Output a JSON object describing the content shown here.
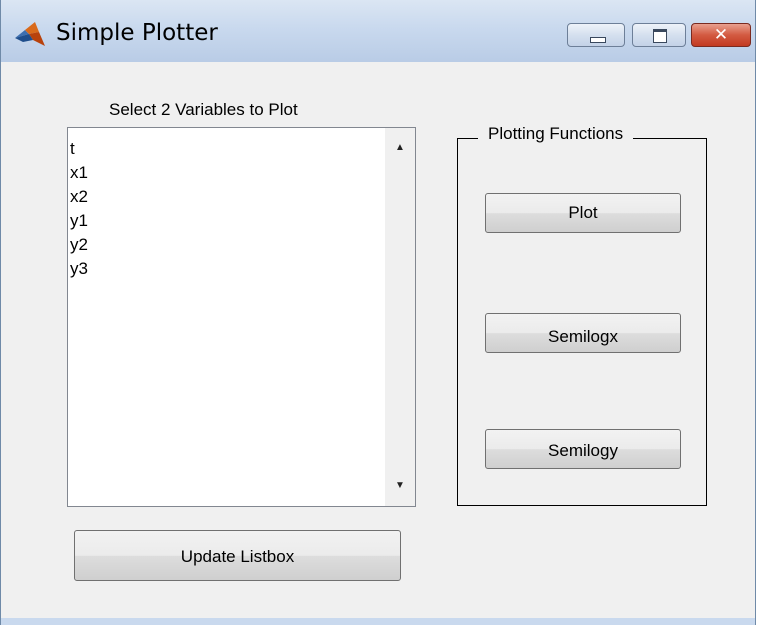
{
  "window": {
    "title": "Simple Plotter",
    "icon": "matlab-icon",
    "controls": {
      "minimize": "minimize-icon",
      "maximize": "maximize-icon",
      "close": "close-icon",
      "close_glyph": "✕"
    }
  },
  "listbox": {
    "title": "Select 2 Variables to Plot",
    "items": [
      "t",
      "x1",
      "x2",
      "y1",
      "y2",
      "y3"
    ],
    "scroll_up": "▲",
    "scroll_down": "▼"
  },
  "panel": {
    "title": "Plotting Functions",
    "buttons": {
      "plot": "Plot",
      "semilogx": "Semilogx",
      "semilogy": "Semilogy"
    }
  },
  "update_button": "Update Listbox",
  "colors": {
    "titlebar": "#c9d9ee",
    "close_button": "#c23a20",
    "background": "#f0f0f0"
  }
}
